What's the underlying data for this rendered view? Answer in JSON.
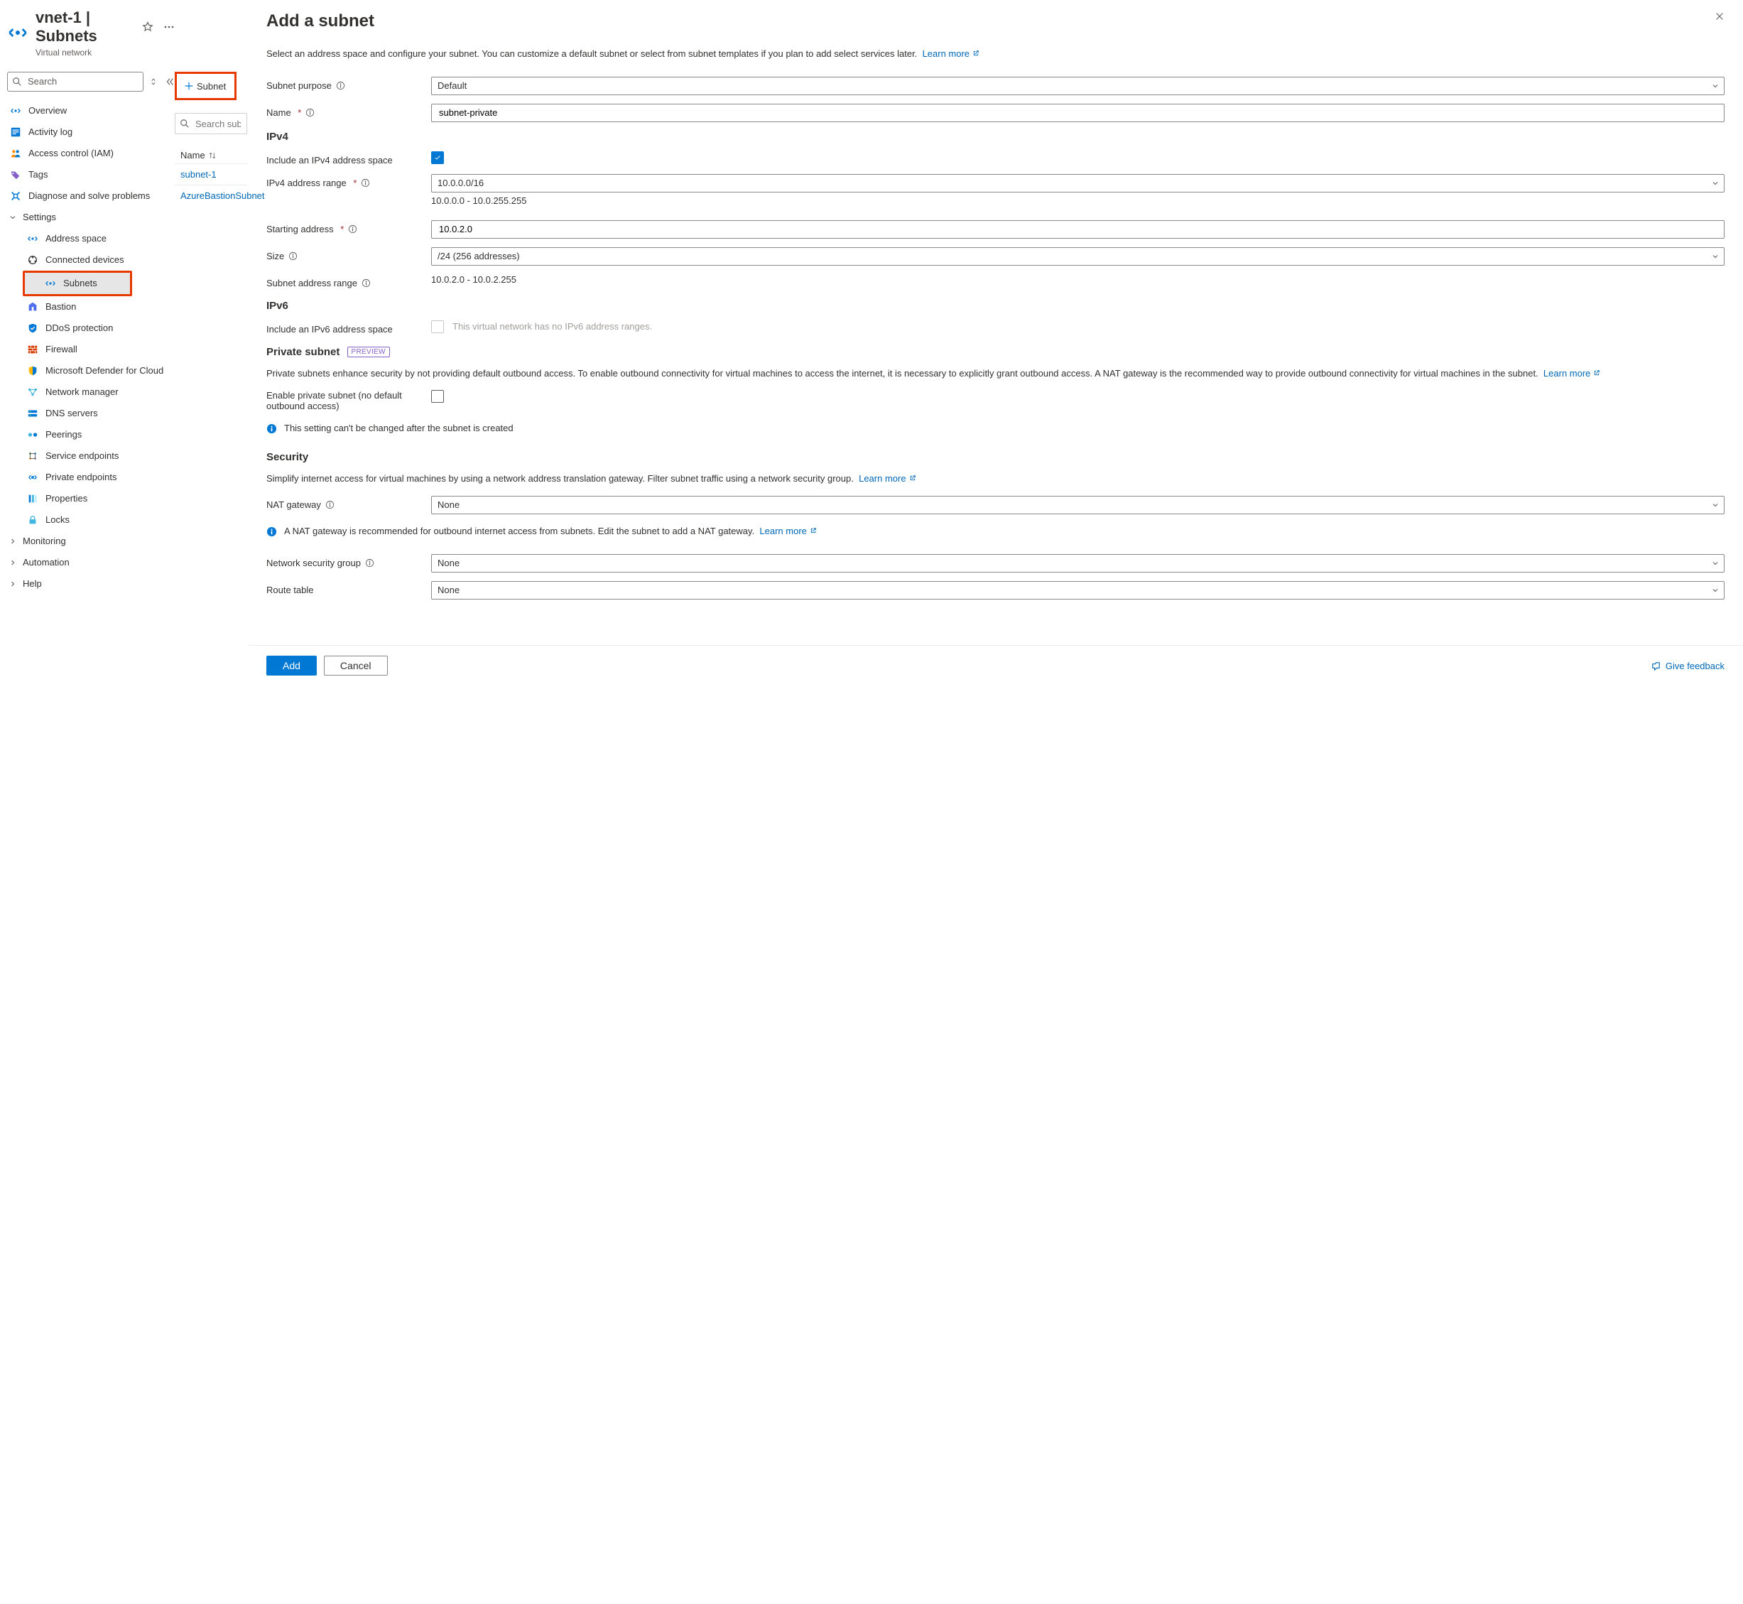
{
  "header": {
    "title": "vnet-1 | Subnets",
    "subtitle": "Virtual network"
  },
  "navSearch": {
    "placeholder": "Search"
  },
  "nav": {
    "items": [
      {
        "label": "Overview",
        "icon": "vnet"
      },
      {
        "label": "Activity log",
        "icon": "activity"
      },
      {
        "label": "Access control (IAM)",
        "icon": "iam"
      },
      {
        "label": "Tags",
        "icon": "tags"
      },
      {
        "label": "Diagnose and solve problems",
        "icon": "diagnose"
      }
    ],
    "settingsLabel": "Settings",
    "settings": [
      {
        "label": "Address space",
        "icon": "vnet"
      },
      {
        "label": "Connected devices",
        "icon": "devices"
      },
      {
        "label": "Subnets",
        "icon": "vnet",
        "selected": true
      },
      {
        "label": "Bastion",
        "icon": "bastion"
      },
      {
        "label": "DDoS protection",
        "icon": "ddos"
      },
      {
        "label": "Firewall",
        "icon": "firewall"
      },
      {
        "label": "Microsoft Defender for Cloud",
        "icon": "defender"
      },
      {
        "label": "Network manager",
        "icon": "netmgr"
      },
      {
        "label": "DNS servers",
        "icon": "dns"
      },
      {
        "label": "Peerings",
        "icon": "peerings"
      },
      {
        "label": "Service endpoints",
        "icon": "svcend"
      },
      {
        "label": "Private endpoints",
        "icon": "pep"
      },
      {
        "label": "Properties",
        "icon": "props"
      },
      {
        "label": "Locks",
        "icon": "locks"
      }
    ],
    "groups": [
      {
        "label": "Monitoring"
      },
      {
        "label": "Automation"
      },
      {
        "label": "Help"
      }
    ]
  },
  "mid": {
    "addSubnet": "Subnet",
    "searchPlaceholder": "Search subnets",
    "nameHeader": "Name",
    "rows": [
      {
        "name": "subnet-1"
      },
      {
        "name": "AzureBastionSubnet"
      }
    ]
  },
  "panel": {
    "title": "Add a subnet",
    "lead": "Select an address space and configure your subnet. You can customize a default subnet or select from subnet templates if you plan to add select services later.",
    "learnMore": "Learn more",
    "labels": {
      "purpose": "Subnet purpose",
      "name": "Name",
      "ipv4": "IPv4",
      "includeIpv4": "Include an IPv4 address space",
      "ipv4Range": "IPv4 address range",
      "startingAddress": "Starting address",
      "size": "Size",
      "subnetAddrRange": "Subnet address range",
      "ipv6": "IPv6",
      "includeIpv6": "Include an IPv6 address space",
      "ipv6Disabled": "This virtual network has no IPv6 address ranges.",
      "privateSubnet": "Private subnet",
      "preview": "PREVIEW",
      "privateDesc": "Private subnets enhance security by not providing default outbound access. To enable outbound connectivity for virtual machines to access the internet, it is necessary to explicitly grant outbound access. A NAT gateway is the recommended way to provide outbound connectivity for virtual machines in the subnet.",
      "enablePrivate": "Enable private subnet (no default outbound access)",
      "privateWarn": "This setting can't be changed after the subnet is created",
      "security": "Security",
      "securityDesc": "Simplify internet access for virtual machines by using a network address translation gateway. Filter subnet traffic using a network security group.",
      "natGateway": "NAT gateway",
      "natInfo": "A NAT gateway is recommended for outbound internet access from subnets. Edit the subnet to add a NAT gateway.",
      "nsg": "Network security group",
      "routeTable": "Route table"
    },
    "values": {
      "purpose": "Default",
      "name": "subnet-private",
      "ipv4Range": "10.0.0.0/16",
      "ipv4RangeHint": "10.0.0.0 - 10.0.255.255",
      "startingAddress": "10.0.2.0",
      "size": "/24 (256 addresses)",
      "subnetAddrRange": "10.0.2.0 - 10.0.2.255",
      "natGateway": "None",
      "nsg": "None",
      "routeTable": "None"
    },
    "footer": {
      "add": "Add",
      "cancel": "Cancel",
      "feedback": "Give feedback"
    }
  }
}
